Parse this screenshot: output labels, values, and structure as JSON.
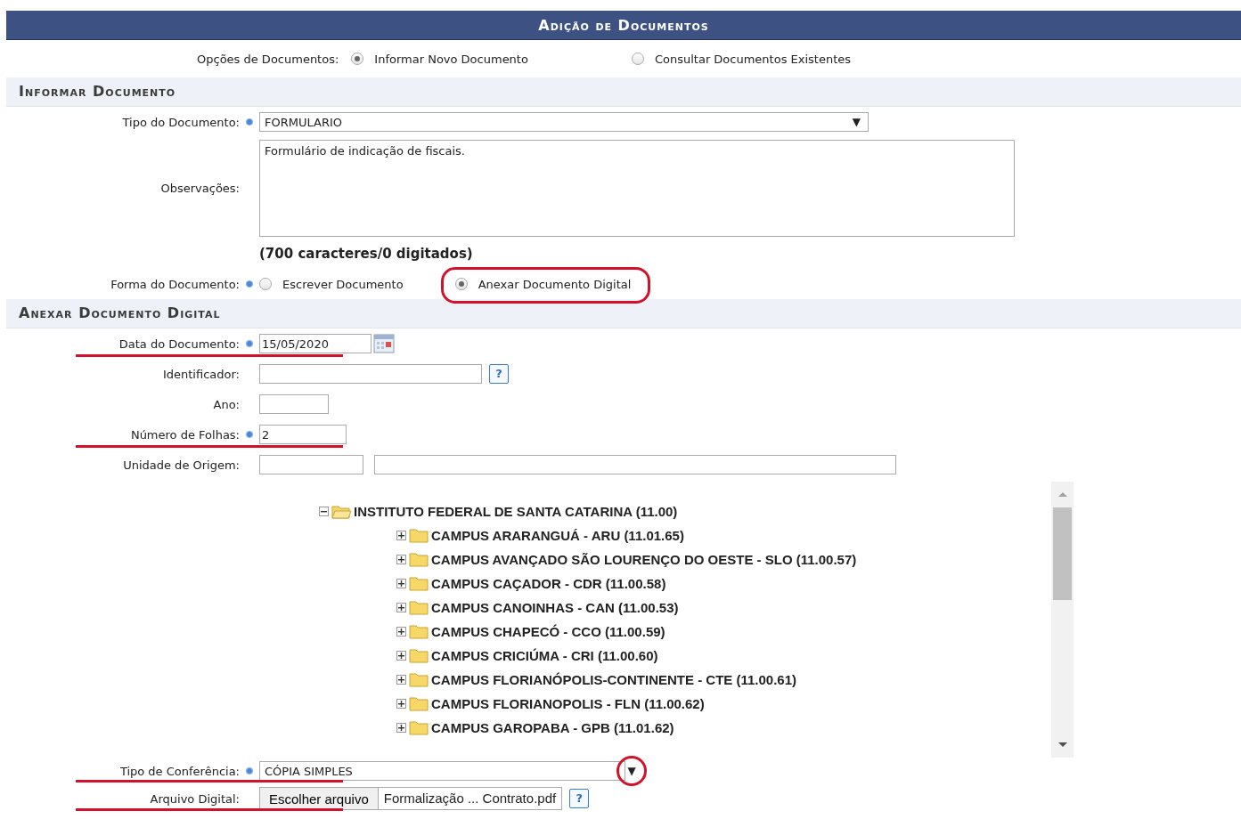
{
  "title": "Adição de Documentos",
  "document_options": {
    "label": "Opções de Documentos:",
    "options": [
      {
        "label": "Informar Novo Documento",
        "selected": true
      },
      {
        "label": "Consultar Documentos Existentes",
        "selected": false
      }
    ]
  },
  "section_1": {
    "title": "Informar Documento"
  },
  "document_type": {
    "label": "Tipo do Documento:",
    "required": true,
    "value": "FORMULARIO",
    "arrow": "▼"
  },
  "observations": {
    "label": "Observações:",
    "value": "Formulário de indicação de fiscais.",
    "counter": "(700 caracteres/0 digitados)"
  },
  "document_form": {
    "label": "Forma do Documento:",
    "required": true,
    "options": [
      {
        "label": "Escrever Documento",
        "selected": false,
        "circled": false
      },
      {
        "label": "Anexar Documento Digital",
        "selected": true,
        "circled": true
      }
    ]
  },
  "section_2": {
    "title": "Anexar Documento Digital"
  },
  "fields": [
    {
      "kind": "date",
      "label": "Data do Documento:",
      "required": true,
      "value": "15/05/2020",
      "underlined": true
    },
    {
      "kind": "help",
      "label": "Identificador:",
      "required": false,
      "help": "?",
      "underlined": false
    },
    {
      "kind": "short",
      "label": "Ano:",
      "required": false,
      "underlined": false
    },
    {
      "kind": "short",
      "label": "Número de Folhas:",
      "required": true,
      "value": "2",
      "underlined": true
    },
    {
      "kind": "unit",
      "label": "Unidade de Origem:",
      "required": false,
      "underlined": false
    }
  ],
  "unit_tree": {
    "label": "INSTITUTO FEDERAL DE SANTA CATARINA (11.00)",
    "expanded": true,
    "children": [
      {
        "label": "CAMPUS ARARANGUÁ - ARU (11.01.65)",
        "expanded": false
      },
      {
        "label": "CAMPUS AVANÇADO SÃO LOURENÇO DO OESTE - SLO (11.00.57)",
        "expanded": false
      },
      {
        "label": "CAMPUS CAÇADOR - CDR (11.00.58)",
        "expanded": false
      },
      {
        "label": "CAMPUS CANOINHAS - CAN (11.00.53)",
        "expanded": false
      },
      {
        "label": "CAMPUS CHAPECÓ - CCO (11.00.59)",
        "expanded": false
      },
      {
        "label": "CAMPUS CRICIÚMA - CRI (11.00.60)",
        "expanded": false
      },
      {
        "label": "CAMPUS FLORIANÓPOLIS-CONTINENTE - CTE (11.00.61)",
        "expanded": false
      },
      {
        "label": "CAMPUS FLORIANOPOLIS - FLN (11.00.62)",
        "expanded": false
      },
      {
        "label": "CAMPUS GAROPABA - GPB (11.01.62)",
        "expanded": false
      }
    ]
  },
  "conference_type": {
    "label": "Tipo de Conferência:",
    "required": true,
    "value": "CÓPIA SIMPLES",
    "arrow": "▼",
    "underlined": true,
    "arrow_circled": true
  },
  "digital_file": {
    "label": "Arquivo Digital:",
    "button": "Escolher arquivo",
    "file_name": "Formalização ... Contrato.pdf",
    "help": "?",
    "underlined": true
  }
}
